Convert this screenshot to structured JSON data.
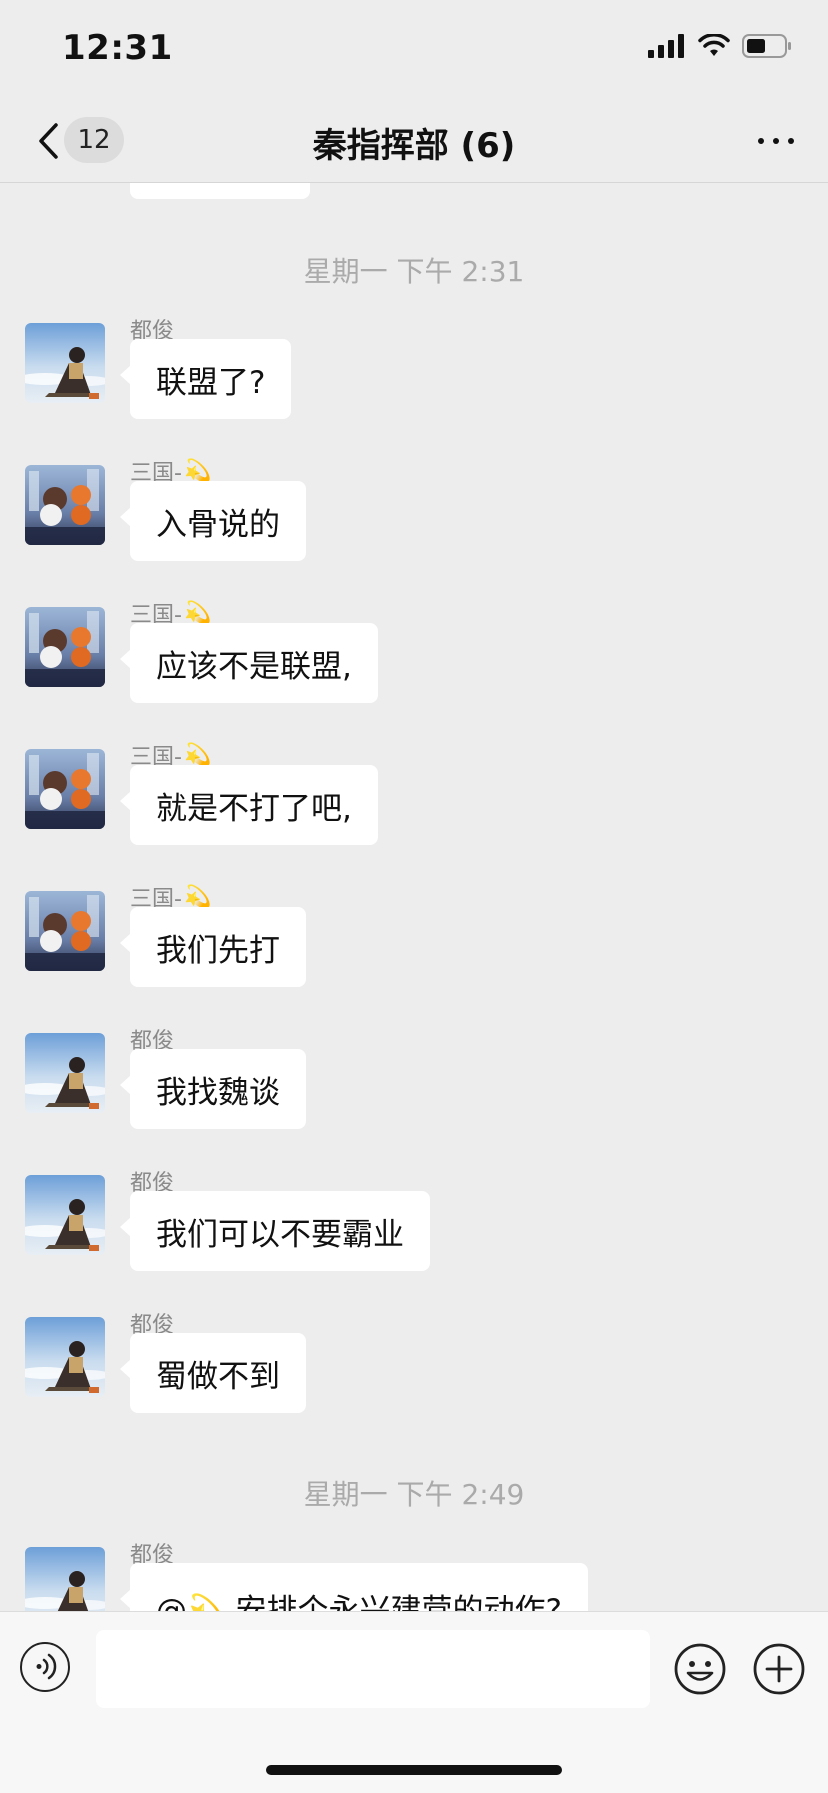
{
  "status_bar": {
    "time": "12:31"
  },
  "nav": {
    "unread_count": "12",
    "title": "秦指挥部 (6)"
  },
  "chat": {
    "time_dividers": [
      "星期一 下午 2:31",
      "星期一 下午 2:49"
    ],
    "messages": [
      {
        "sender": "都俊",
        "text": "联盟了?",
        "avatar": "seated-figure-avatar"
      },
      {
        "sender": "三国-",
        "sender_emoji": "💫",
        "text": "入骨说的",
        "avatar": "toys-avatar"
      },
      {
        "sender": "三国-",
        "sender_emoji": "💫",
        "text": "应该不是联盟,",
        "avatar": "toys-avatar"
      },
      {
        "sender": "三国-",
        "sender_emoji": "💫",
        "text": "就是不打了吧,",
        "avatar": "toys-avatar"
      },
      {
        "sender": "三国-",
        "sender_emoji": "💫",
        "text": "我们先打",
        "avatar": "toys-avatar"
      },
      {
        "sender": "都俊",
        "text": "我找魏谈",
        "avatar": "seated-figure-avatar"
      },
      {
        "sender": "都俊",
        "text": "我们可以不要霸业",
        "avatar": "seated-figure-avatar"
      },
      {
        "sender": "都俊",
        "text": "蜀做不到",
        "avatar": "seated-figure-avatar"
      },
      {
        "sender": "都俊",
        "text": "@💫 安排个永兴建营的动作?",
        "avatar": "seated-figure-avatar"
      }
    ]
  },
  "input_bar": {
    "voice_icon": "voice-icon",
    "emoji_icon": "emoji-icon",
    "plus_icon": "plus-icon",
    "text_value": ""
  },
  "colors": {
    "background": "#ededed",
    "bubble": "#ffffff",
    "meta_text": "#aaaaaa"
  }
}
